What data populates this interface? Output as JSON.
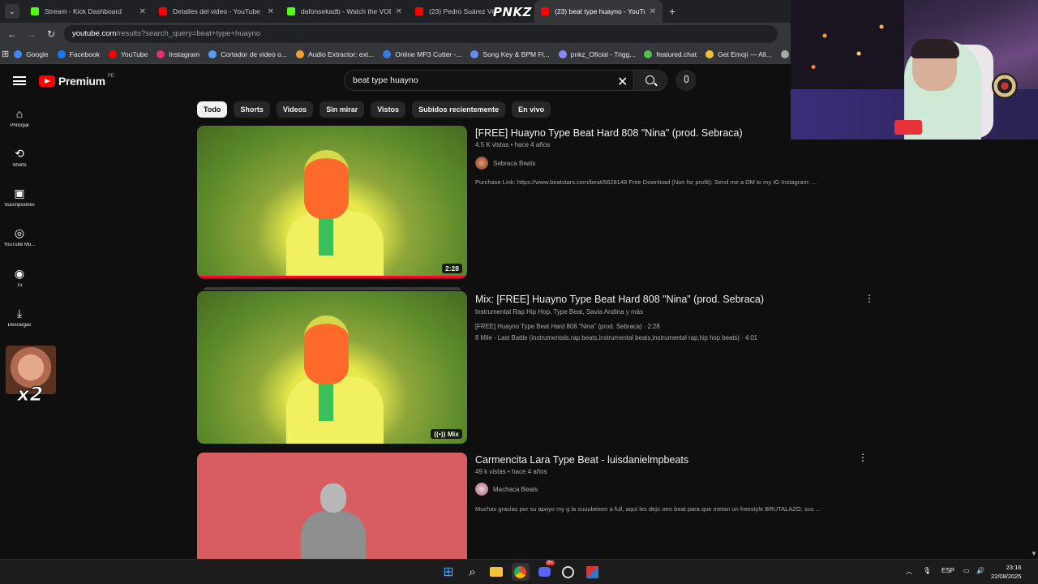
{
  "browser": {
    "tabs": [
      {
        "title": "Stream - Kick Dashboard",
        "color": "#53fc18"
      },
      {
        "title": "Detalles del video - YouTube St",
        "color": "#ff0000"
      },
      {
        "title": "dafonsekadb - Watch the VOD",
        "color": "#53fc18"
      },
      {
        "title": "(23) Pedro Suárez Vér",
        "color": "#ff0000"
      },
      {
        "title": "(23) beat type huayno - YouTub",
        "color": "#ff0000"
      }
    ],
    "overlay_logo": "PNKZ",
    "url_host": "youtube.com",
    "url_path": "/results?search_query=beat+type+huayno",
    "bookmarks": [
      {
        "label": "Google",
        "color": "#4285f4"
      },
      {
        "label": "Facebook",
        "color": "#1877f2"
      },
      {
        "label": "YouTube",
        "color": "#ff0000"
      },
      {
        "label": "Instagram",
        "color": "#e1306c"
      },
      {
        "label": "Cortador de video o...",
        "color": "#5a9cf0"
      },
      {
        "label": "Audio Extractor: ext...",
        "color": "#f0a030"
      },
      {
        "label": "Online MP3 Cutter -...",
        "color": "#3a7ae0"
      },
      {
        "label": "Song Key & BPM Fi...",
        "color": "#6a8af0"
      },
      {
        "label": "pnkz_Oficial - Trigg...",
        "color": "#8a8aff"
      },
      {
        "label": "featured.chat",
        "color": "#50c050"
      },
      {
        "label": "Get Emoji — All...",
        "color": "#f0c030"
      },
      {
        "label": "C",
        "color": "#aaaaaa"
      }
    ]
  },
  "youtube": {
    "logo_text": "Premium",
    "region": "PE",
    "search_value": "beat type huayno",
    "sidebar": [
      {
        "label": "Principal",
        "icon": "⌂"
      },
      {
        "label": "Shorts",
        "icon": "⟲"
      },
      {
        "label": "Suscripciones",
        "icon": "▣"
      },
      {
        "label": "YouTube Mu...",
        "icon": "◎"
      },
      {
        "label": "Tú",
        "icon": "◉"
      },
      {
        "label": "Descargas",
        "icon": "⤓"
      }
    ],
    "emote_text": "x2",
    "chips": [
      "Todo",
      "Shorts",
      "Videos",
      "Sin mirar",
      "Vistos",
      "Subidos recientemente",
      "En vivo"
    ],
    "results": [
      {
        "title": "[FREE] Huayno Type Beat Hard 808 \"Nina\" (prod. Sebraca)",
        "meta": "4.5 K vistas • hace 4 años",
        "channel": "Sebraca Beats",
        "description": "Purchase Link: https://www.beatstars.com/beat/6628148 Free Download (Non for profit): Send me a DM to my IG Instagram: ...",
        "duration": "2:28"
      },
      {
        "title": "Mix: [FREE] Huayno Type Beat Hard 808 \"Nina\" (prod. Sebraca)",
        "meta": "Instrumental Rap Hip Hop, Type Beat, Savia Andina y más",
        "line1": "[FREE] Huayno Type Beat Hard 808 \"Nina\" (prod. Sebraca) · 2:28",
        "line2": "8 Mile - Last Battle (instrumentals,rap beats,instrumental beats,instrumental rap,hip hop beats) · 4:01",
        "badge": "((•)) Mix"
      },
      {
        "title": "Carmencita Lara Type Beat - luisdanielmpbeats",
        "meta": "49 k vistas • hace 4 años",
        "channel": "Machaca Beats",
        "description": "Muchas gracias por su apoyo my g la suuubeeen a full, aquí les dejo otro beat para que metan un freestyle BRUTALAZO, sus ..."
      }
    ]
  },
  "taskbar": {
    "lang": "ESP",
    "time": "23:16",
    "date": "22/08/2025",
    "discord_badge": "9+"
  }
}
